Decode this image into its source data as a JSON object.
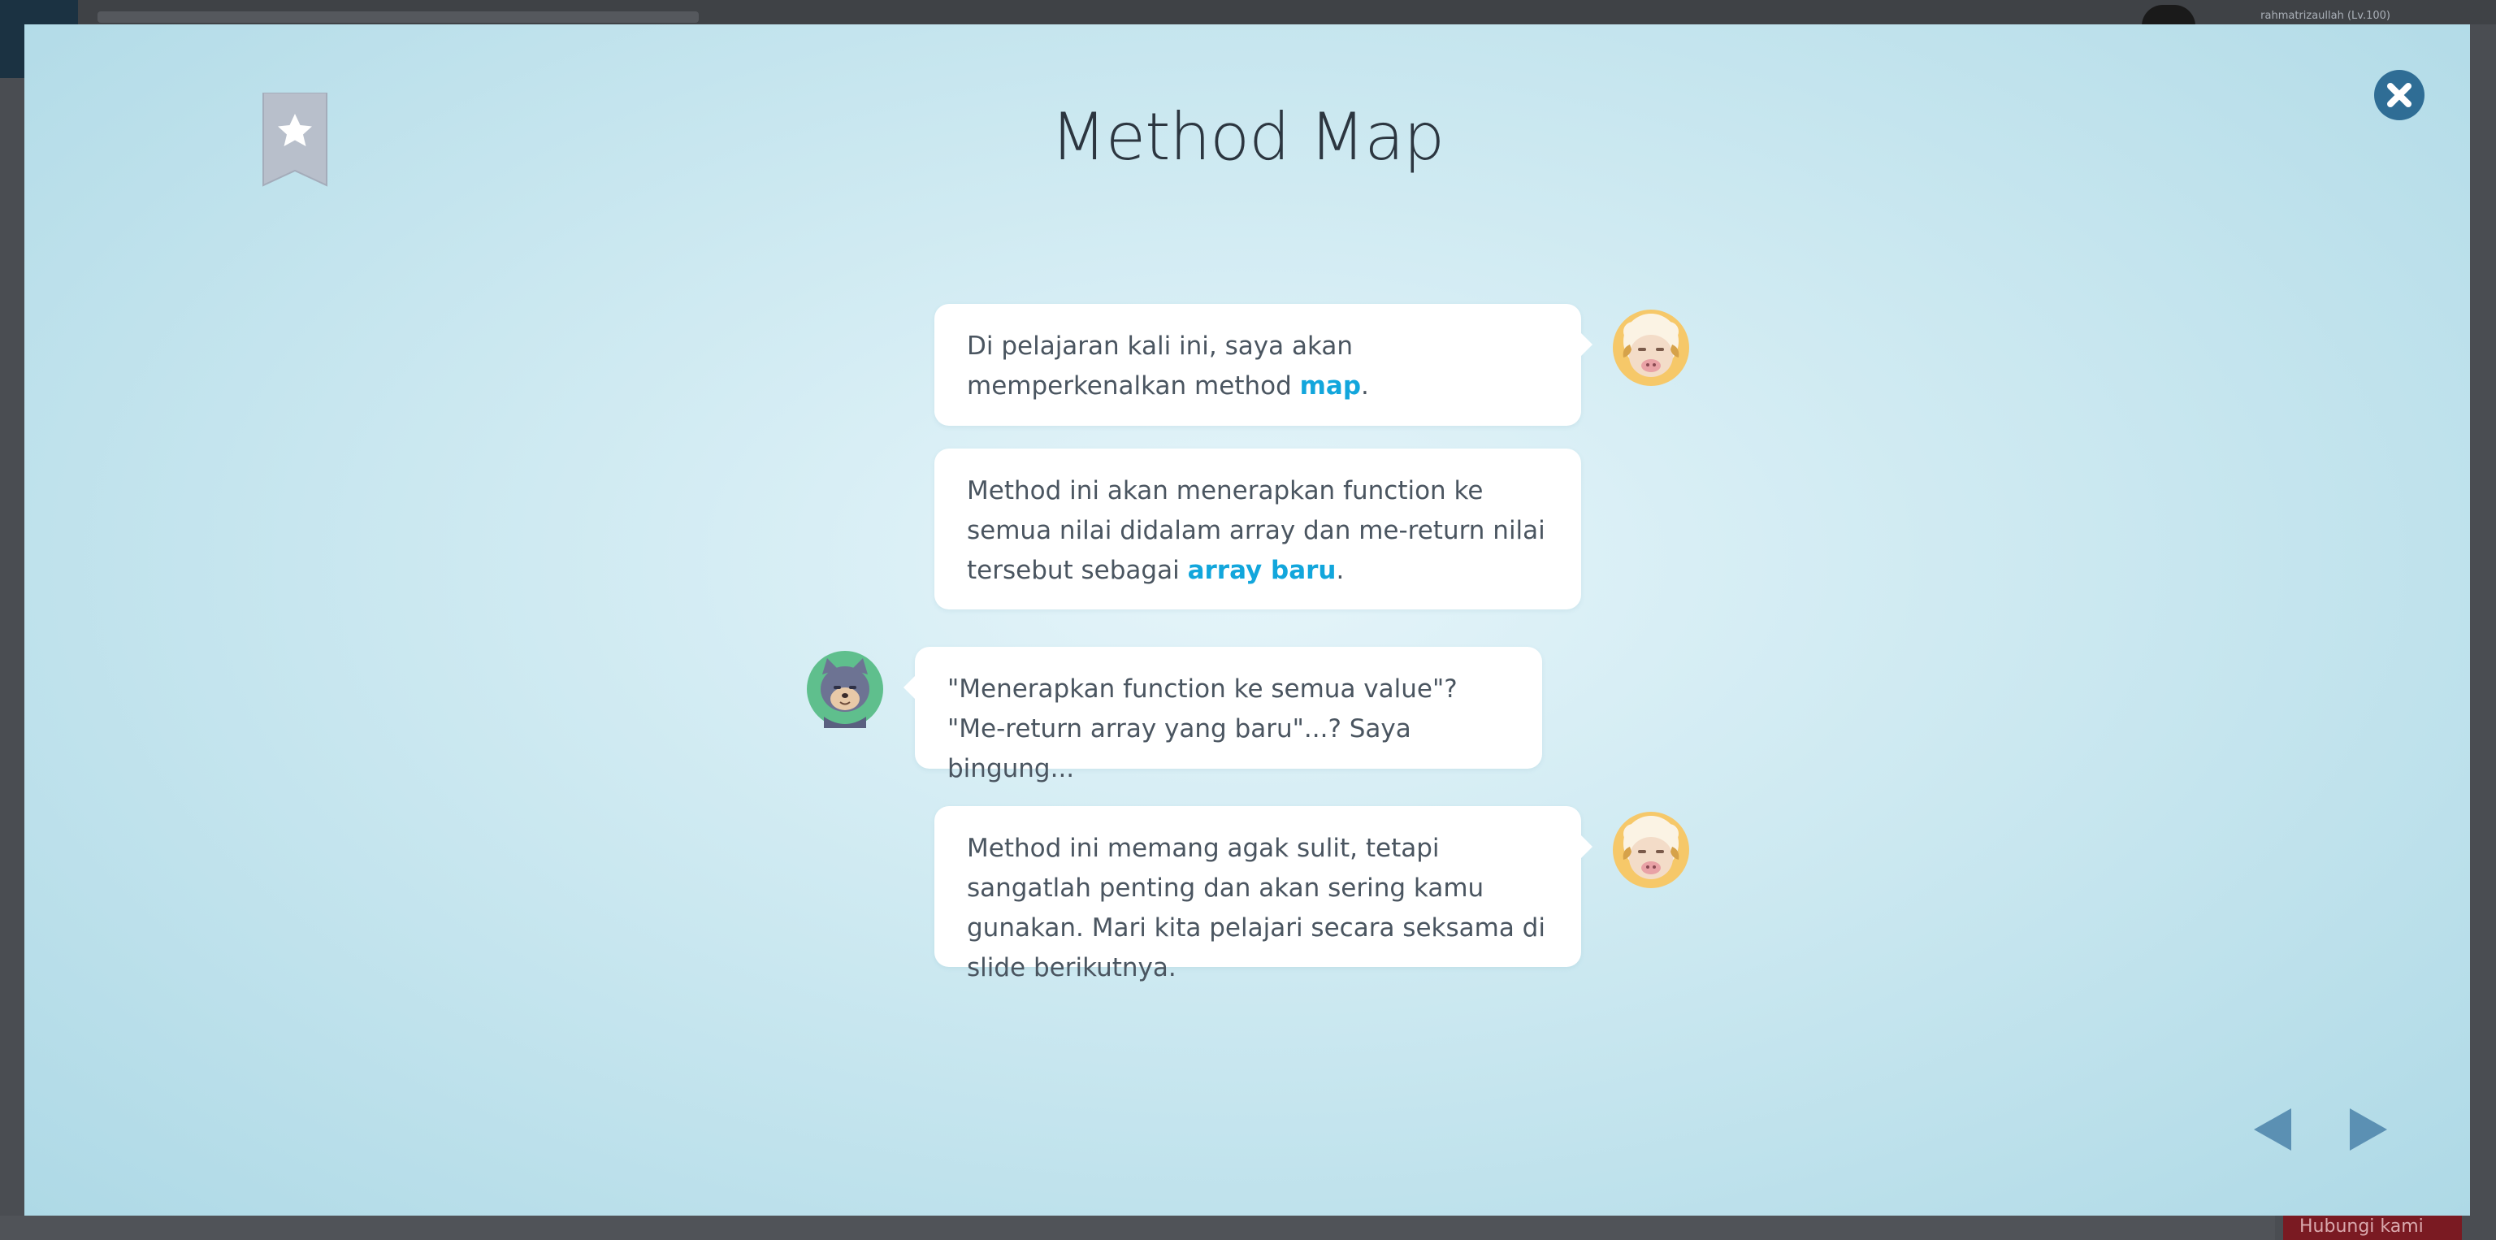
{
  "background": {
    "user_label": "rahmatrizaullah (Lv.100)",
    "bottom_button_label": "Hubungi kami"
  },
  "modal": {
    "title": "Method Map",
    "conversation": [
      {
        "speaker": "sheep-mentor",
        "side": "right",
        "parts": [
          {
            "text": "Di pelajaran kali ini, saya akan memperkenalkan method ",
            "highlight": false
          },
          {
            "text": "map",
            "highlight": true
          },
          {
            "text": ".",
            "highlight": false
          }
        ]
      },
      {
        "speaker": "sheep-mentor",
        "side": "right",
        "parts": [
          {
            "text": "Method ini akan menerapkan function ke semua nilai didalam array dan me-return nilai tersebut sebagai ",
            "highlight": false
          },
          {
            "text": "array baru",
            "highlight": true
          },
          {
            "text": ".",
            "highlight": false
          }
        ]
      },
      {
        "speaker": "cat-student",
        "side": "left",
        "parts": [
          {
            "text": "\"Menerapkan function ke semua value\"? \"Me-return array yang baru\"...? Saya bingung...",
            "highlight": false
          }
        ]
      },
      {
        "speaker": "sheep-mentor",
        "side": "right",
        "parts": [
          {
            "text": "Method ini memang agak sulit, tetapi sangatlah penting dan akan sering kamu gunakan. Mari kita pelajari secara seksama di slide berikutnya.",
            "highlight": false
          }
        ]
      }
    ],
    "icons": {
      "bookmark": "bookmark-star-icon",
      "close": "close-icon",
      "prev": "arrow-left-icon",
      "next": "arrow-right-icon"
    },
    "colors": {
      "highlight": "#12a6dc",
      "close_button": "#2f6d95",
      "nav_arrow": "#5b90b3",
      "bookmark": "#b8bfcb"
    }
  }
}
